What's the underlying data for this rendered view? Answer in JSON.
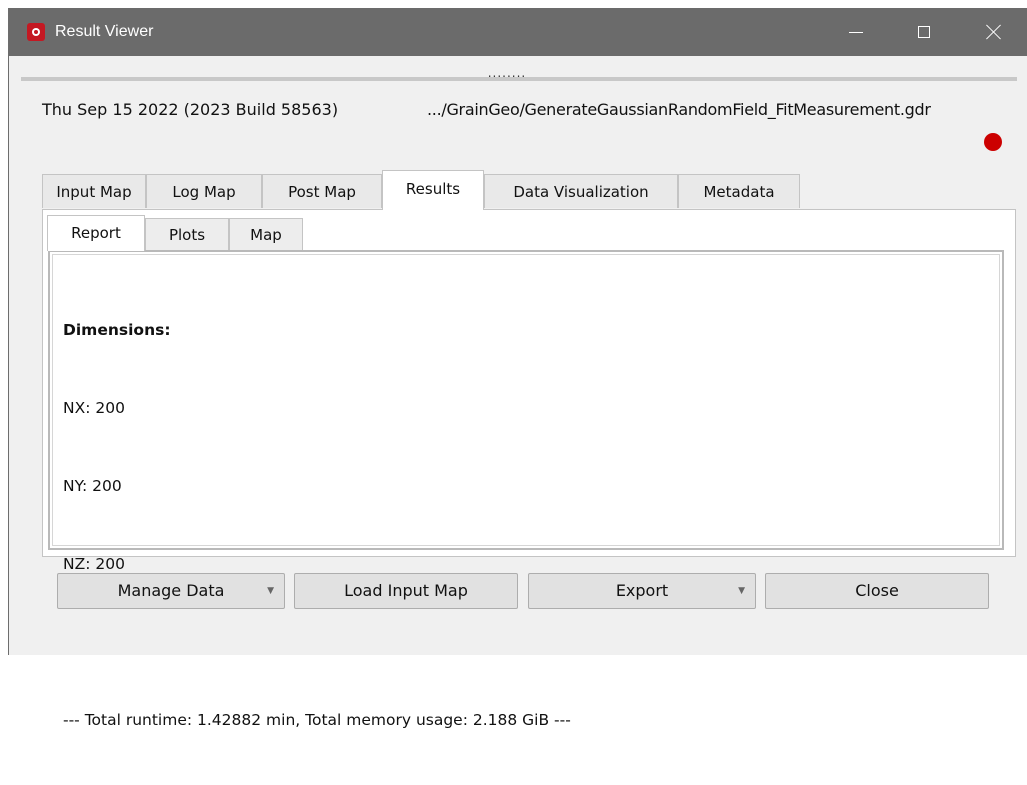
{
  "window": {
    "title": "Result Viewer",
    "controls": {
      "minimize": "minimize-icon",
      "maximize": "maximize-icon",
      "close": "close-icon"
    }
  },
  "splitter": {
    "handle": "........"
  },
  "info": {
    "date_build": "Thu Sep 15 2022 (2023 Build 58563)",
    "path": ".../GrainGeo/GenerateGaussianRandomField_FitMeasurement.gdr",
    "status_color": "#cc0000"
  },
  "tabs": [
    {
      "label": "Input Map"
    },
    {
      "label": "Log Map"
    },
    {
      "label": "Post Map"
    },
    {
      "label": "Results",
      "active": true
    },
    {
      "label": "Data Visualization"
    },
    {
      "label": "Metadata"
    }
  ],
  "subtabs": [
    {
      "label": "Report",
      "active": true
    },
    {
      "label": "Plots"
    },
    {
      "label": "Map"
    }
  ],
  "report": {
    "heading": "Dimensions:",
    "lines": [
      "NX: 200",
      "NY: 200",
      "NZ: 200"
    ],
    "summary": "--- Total runtime: 1.42882 min, Total memory usage: 2.188 GiB ---"
  },
  "buttons": {
    "manage_data": "Manage Data",
    "load_input_map": "Load Input Map",
    "export": "Export",
    "close": "Close",
    "dropdown_caret": "▼"
  }
}
